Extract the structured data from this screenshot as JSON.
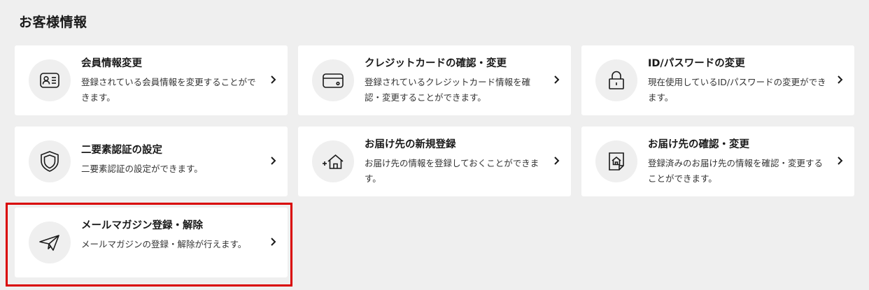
{
  "page": {
    "title": "お客様情報"
  },
  "colors": {
    "background": "#efefef",
    "card": "#ffffff",
    "icon_circle": "#efefef",
    "highlight": "#d90000"
  },
  "cards": [
    {
      "title": "会員情報変更",
      "description": "登録されている会員情報を変更することができます。",
      "icon": "member-card-icon"
    },
    {
      "title": "クレジットカードの確認・変更",
      "description": "登録されているクレジットカード情報を確認・変更することができます。",
      "icon": "credit-card-icon"
    },
    {
      "title": "ID/パスワードの変更",
      "description": "現在使用しているID/パスワードの変更ができます。",
      "icon": "lock-icon"
    },
    {
      "title": "二要素認証の設定",
      "description": "二要素認証の設定ができます。",
      "icon": "shield-icon"
    },
    {
      "title": "お届け先の新規登録",
      "description": "お届け先の情報を登録しておくことができます。",
      "icon": "add-home-icon"
    },
    {
      "title": "お届け先の確認・変更",
      "description": "登録済みのお届け先の情報を確認・変更することができます。",
      "icon": "home-document-icon"
    },
    {
      "title": "メールマガジン登録・解除",
      "description": "メールマガジンの登録・解除が行えます。",
      "icon": "paper-plane-icon",
      "selected": true
    }
  ]
}
